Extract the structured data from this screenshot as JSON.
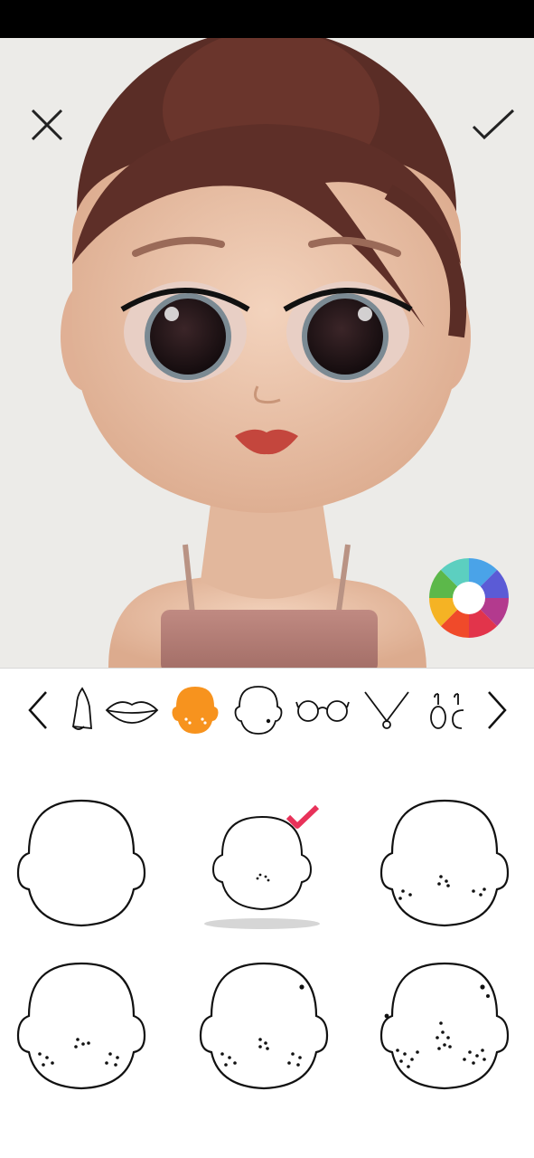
{
  "app": {
    "screen": "avatar-face-editor"
  },
  "colors": {
    "accent_selected_tool": "#f7931e",
    "checkmark": "#e8325a",
    "background_canvas": "#ecebe8",
    "outline": "#1a1a1a"
  },
  "header": {
    "close_icon": "close-icon",
    "confirm_icon": "checkmark-icon"
  },
  "toolbar": {
    "items": [
      {
        "name": "prev-arrow-icon",
        "selected": false
      },
      {
        "name": "nose-icon",
        "selected": false
      },
      {
        "name": "lips-icon",
        "selected": false
      },
      {
        "name": "face-details-icon",
        "selected": true
      },
      {
        "name": "head-shape-icon",
        "selected": false
      },
      {
        "name": "glasses-icon",
        "selected": false
      },
      {
        "name": "necklace-icon",
        "selected": false
      },
      {
        "name": "earrings-icon",
        "selected": false
      },
      {
        "name": "next-arrow-icon",
        "selected": false
      }
    ]
  },
  "options": {
    "items": [
      {
        "name": "freckles-none",
        "selected": false
      },
      {
        "name": "freckles-nose-light",
        "selected": true
      },
      {
        "name": "freckles-cheeks-light",
        "selected": false
      },
      {
        "name": "freckles-cheeks-medium",
        "selected": false
      },
      {
        "name": "freckles-cheeks-mole",
        "selected": false
      },
      {
        "name": "freckles-full",
        "selected": false
      }
    ]
  }
}
